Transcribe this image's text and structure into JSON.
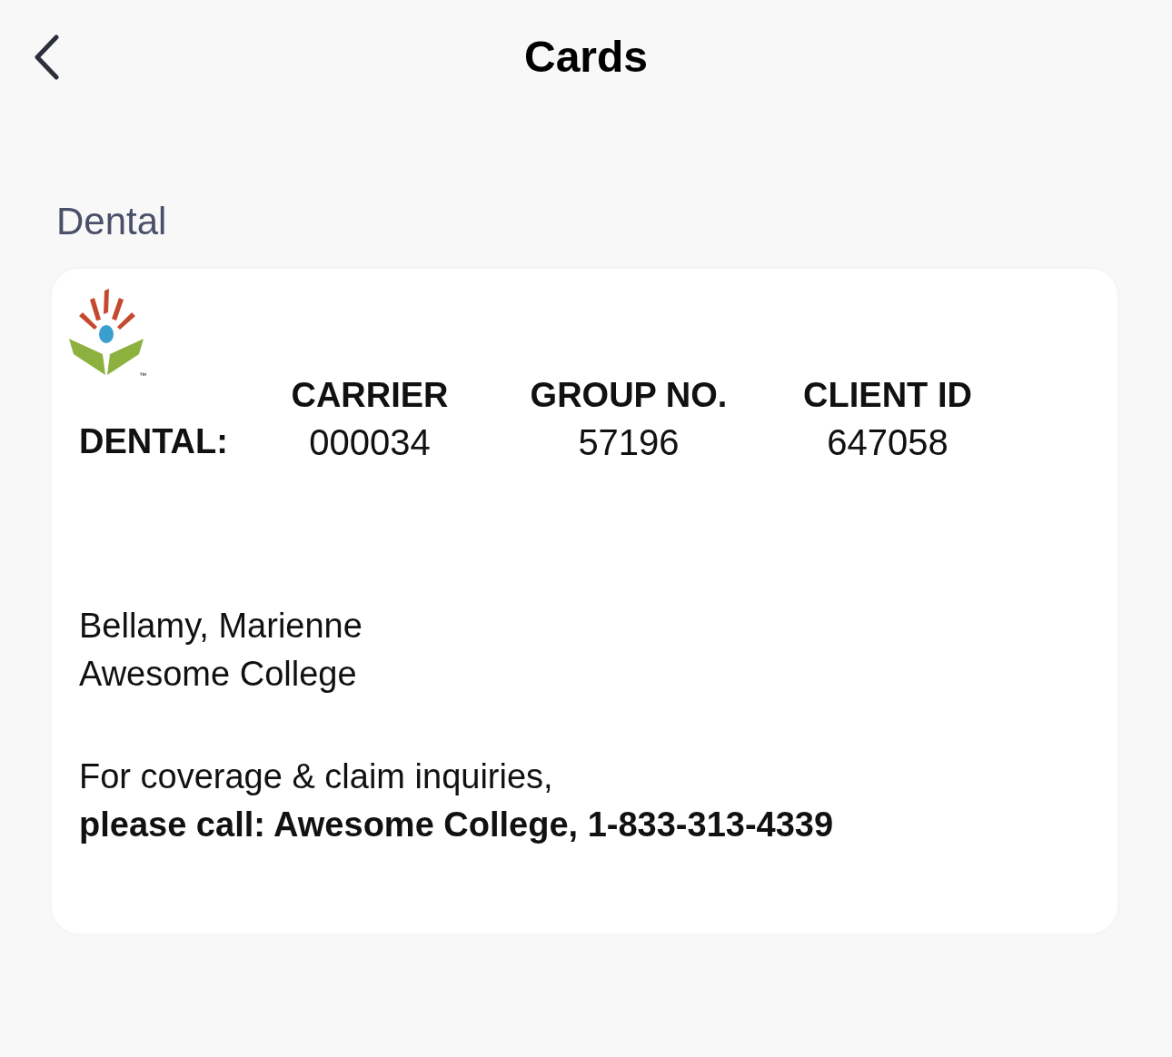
{
  "header": {
    "title": "Cards"
  },
  "section": {
    "title": "Dental"
  },
  "card": {
    "trademark": "™",
    "plan_label": "DENTAL:",
    "fields": [
      {
        "label": "CARRIER",
        "value": "000034"
      },
      {
        "label": "GROUP NO.",
        "value": "57196"
      },
      {
        "label": "CLIENT ID",
        "value": "647058"
      }
    ],
    "member_name": "Bellamy, Marienne",
    "organization": "Awesome College",
    "contact_line_1": "For coverage & claim inquiries,",
    "contact_line_2": "please call: Awesome College, 1-833-313-4339"
  }
}
